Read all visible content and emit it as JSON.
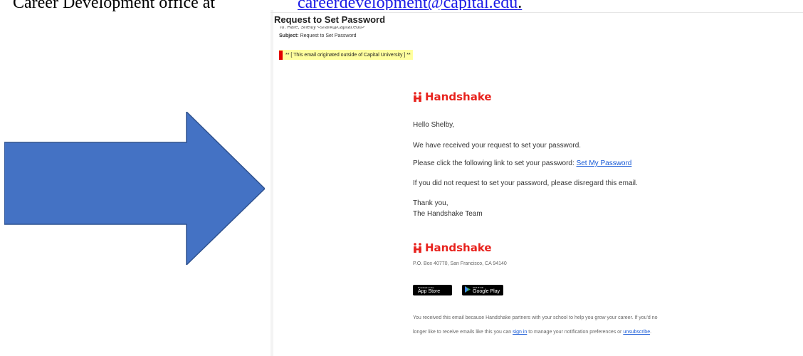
{
  "document": {
    "line_text": "Career Development office at ",
    "line_link": "careerdevelopment@capital.edu",
    "line_end": "."
  },
  "email": {
    "subject_title": "Request to Set Password",
    "to_line": "To: Hare, Shelby <shark@capital.edu>",
    "subject_label": "Subject:",
    "subject_value": "Request to Set Password",
    "external_warning": "** [ This email originated outside of Capital University ] **",
    "logo_text": "Handshake",
    "greeting": "Hello Shelby,",
    "received": "We have received your request to set your password.",
    "click_prefix": "Please click the following link to set your password: ",
    "click_link": "Set My Password",
    "ignore": "If you did not request to set your password, please disregard this email.",
    "thanks": "Thank you,",
    "team": "The Handshake Team",
    "address": "P.O. Box 40770, San Francisco, CA 94140",
    "app_store": {
      "small": "Download on the",
      "big": "App Store"
    },
    "google_play": {
      "small": "GET IT ON",
      "big": "Google Play"
    },
    "footer": {
      "p1": "You received this email because Handshake partners with your school to help you grow your career. If you'd no longer like to receive emails like this you can ",
      "sign_in": "sign in",
      "p2": " to manage your notification preferences or ",
      "unsubscribe": "unsubscribe",
      "p3": "."
    }
  },
  "colors": {
    "arrow": "#4472c4",
    "handshake_red": "#e8231e",
    "warning_bg": "#ffff9e",
    "link": "#1558d6"
  },
  "icons": {
    "arrow": "right-arrow-icon",
    "logo": "handshake-logo-icon",
    "apple": "apple-icon",
    "play": "google-play-icon"
  }
}
